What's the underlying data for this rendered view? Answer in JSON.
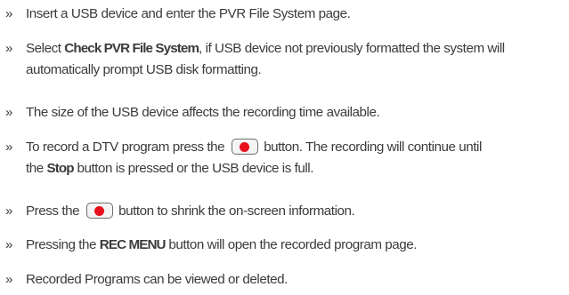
{
  "bullet_mark": "»",
  "items": [
    {
      "text": "Insert a USB device and enter the PVR File System page."
    },
    {
      "pre": "Select ",
      "bold": "Check PVR File System",
      "post": ", if USB device not previously formatted the system will",
      "line2": "automatically prompt USB disk formatting."
    },
    {
      "text": "The size of the USB device affects the recording time available."
    },
    {
      "pre": "To record a DTV program press the",
      "post": "button. The recording will continue until",
      "line2_pre": "the ",
      "line2_bold": "Stop",
      "line2_post": " button is pressed or the USB device is full."
    },
    {
      "pre": "Press the",
      "post": "button to shrink the on-screen information."
    },
    {
      "pre": "Pressing the ",
      "bold": "REC MENU",
      "post": " button will open the recorded program page."
    },
    {
      "text": "Recorded Programs can be viewed or deleted."
    }
  ],
  "icons": {
    "record_button": "record-button-icon",
    "record_color": "#e8101c"
  }
}
